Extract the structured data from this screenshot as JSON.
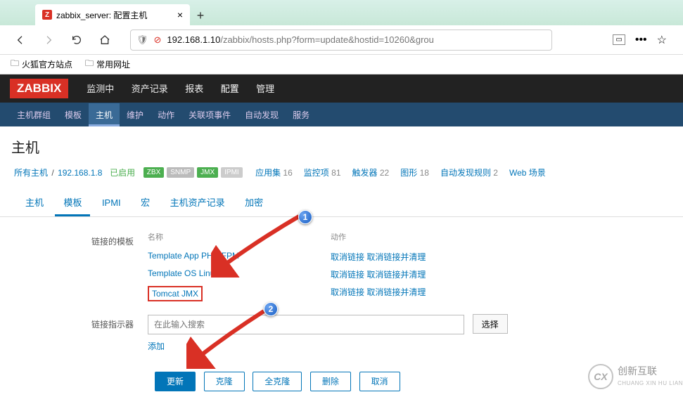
{
  "browser": {
    "tab_favicon": "Z",
    "tab_title": "zabbix_server: 配置主机",
    "url_display_host": "192.168.1.10",
    "url_display_path": "/zabbix/hosts.php?form=update&hostid=10260&grou",
    "bookmarks": [
      "火狐官方站点",
      "常用网址"
    ]
  },
  "zabbix": {
    "logo": "ZABBIX",
    "main_nav": [
      {
        "label": "监测中",
        "active": false
      },
      {
        "label": "资产记录",
        "active": false
      },
      {
        "label": "报表",
        "active": false
      },
      {
        "label": "配置",
        "active": true
      },
      {
        "label": "管理",
        "active": false
      }
    ],
    "sub_nav": [
      {
        "label": "主机群组",
        "active": false
      },
      {
        "label": "模板",
        "active": false
      },
      {
        "label": "主机",
        "active": true
      },
      {
        "label": "维护",
        "active": false
      },
      {
        "label": "动作",
        "active": false
      },
      {
        "label": "关联项事件",
        "active": false
      },
      {
        "label": "自动发现",
        "active": false
      },
      {
        "label": "服务",
        "active": false
      }
    ],
    "page_title": "主机",
    "breadcrumb": {
      "all": "所有主机",
      "host": "192.168.1.8",
      "status": "已启用"
    },
    "availability": [
      {
        "label": "ZBX",
        "cls": "b-green"
      },
      {
        "label": "SNMP",
        "cls": "b-grey"
      },
      {
        "label": "JMX",
        "cls": "b-jmx"
      },
      {
        "label": "IPMI",
        "cls": "b-ipmi"
      }
    ],
    "counters": [
      {
        "label": "应用集",
        "count": 16
      },
      {
        "label": "监控项",
        "count": 81
      },
      {
        "label": "触发器",
        "count": 22
      },
      {
        "label": "图形",
        "count": 18
      },
      {
        "label": "自动发现规则",
        "count": 2
      },
      {
        "label": "Web 场景",
        "count": ""
      }
    ],
    "tabs": [
      {
        "label": "主机",
        "active": false
      },
      {
        "label": "模板",
        "active": true
      },
      {
        "label": "IPMI",
        "active": false
      },
      {
        "label": "宏",
        "active": false
      },
      {
        "label": "主机资产记录",
        "active": false
      },
      {
        "label": "加密",
        "active": false
      }
    ],
    "form": {
      "linked_templates_label": "链接的模板",
      "col_name": "名称",
      "col_action": "动作",
      "templates": [
        {
          "name": "Template App PHP-FPM",
          "unlink": "取消链接",
          "clear": "取消链接并清理",
          "highlight": false
        },
        {
          "name": "Template OS Linux",
          "unlink": "取消链接",
          "clear": "取消链接并清理",
          "highlight": false
        },
        {
          "name": "Tomcat JMX",
          "unlink": "取消链接",
          "clear": "取消链接并清理",
          "highlight": true
        }
      ],
      "link_new_label": "链接指示器",
      "search_placeholder": "在此输入搜索",
      "select_btn": "选择",
      "add_link": "添加",
      "buttons": {
        "update": "更新",
        "clone": "克隆",
        "full_clone": "全克隆",
        "delete": "删除",
        "cancel": "取消"
      }
    }
  },
  "annotations": {
    "one": "1",
    "two": "2"
  },
  "watermark": {
    "logo": "CX",
    "name": "创新互联",
    "pinyin": "CHUANG XIN HU LIAN"
  }
}
